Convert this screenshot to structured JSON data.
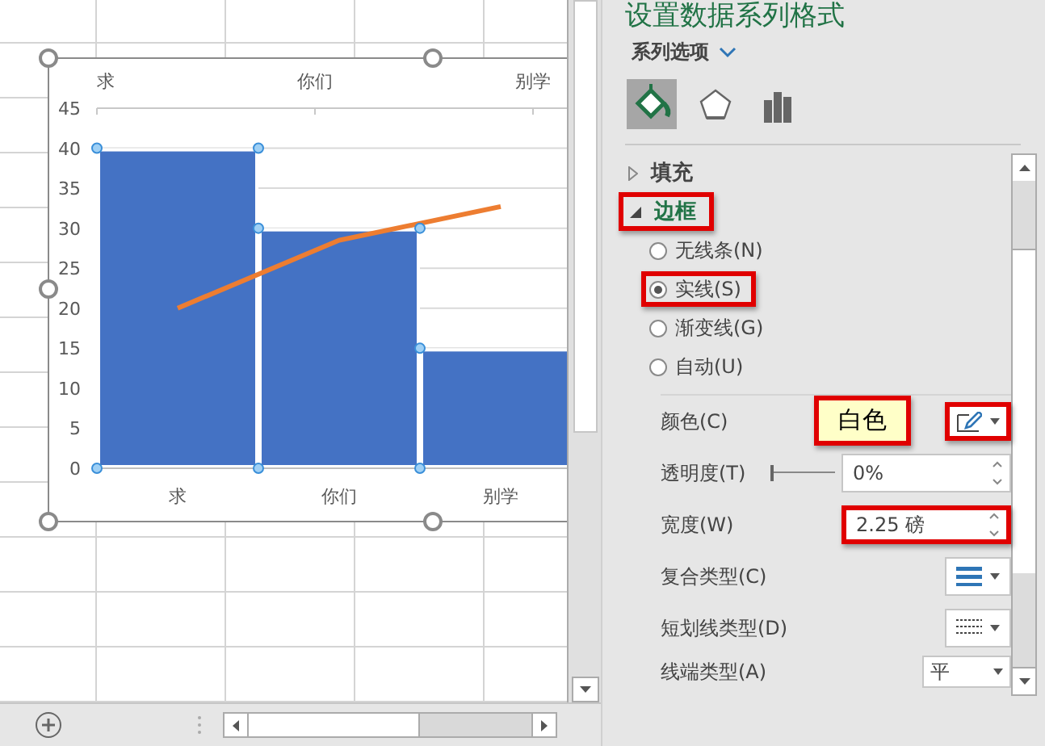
{
  "sheet": {
    "chart": {
      "top_axis": [
        "求",
        "你们",
        "别学"
      ],
      "chart_data": {
        "type": "bar",
        "categories": [
          "求",
          "你们",
          "别学"
        ],
        "series": [
          {
            "type": "bar",
            "color": "#4472c4",
            "values": [
              40,
              30,
              15
            ]
          },
          {
            "type": "line",
            "color": "#ed7d31",
            "values": [
              20,
              28.5,
              32.7
            ]
          }
        ],
        "grid": true,
        "ylim": [
          0,
          45
        ],
        "yticks": [
          0,
          5,
          10,
          15,
          20,
          25,
          30,
          35,
          40,
          45
        ]
      }
    }
  },
  "pane": {
    "title": "设置数据系列格式",
    "options_label": "系列选项",
    "tabs": [
      {
        "kind": "fill",
        "selected": true
      },
      {
        "kind": "shape",
        "selected": false
      },
      {
        "kind": "bars",
        "selected": false
      }
    ],
    "sections": [
      {
        "label": "填充",
        "expanded": false,
        "highlighted": false
      },
      {
        "label": "边框",
        "expanded": true,
        "highlighted": true
      }
    ],
    "line_options": [
      {
        "label": "无线条(N)",
        "selected": false,
        "highlighted": false
      },
      {
        "label": "实线(S)",
        "selected": true,
        "highlighted": true
      },
      {
        "label": "渐变线(G)",
        "selected": false,
        "highlighted": false
      },
      {
        "label": "自动(U)",
        "selected": false,
        "highlighted": false
      }
    ],
    "properties": [
      {
        "kind": "color",
        "label": "颜色(C)",
        "highlighted": true,
        "tooltip": "白色"
      },
      {
        "kind": "slider",
        "label": "透明度(T)",
        "value": "0%",
        "level": 0,
        "highlighted": false
      },
      {
        "kind": "spin",
        "label": "宽度(W)",
        "value": "2.25 磅",
        "highlighted": true
      },
      {
        "kind": "compound",
        "label": "复合类型(C)",
        "highlighted": false
      },
      {
        "kind": "dash",
        "label": "短划线类型(D)",
        "highlighted": false
      },
      {
        "kind": "dropdown",
        "label": "线端类型(A)",
        "value": "平",
        "highlighted": false
      }
    ]
  }
}
